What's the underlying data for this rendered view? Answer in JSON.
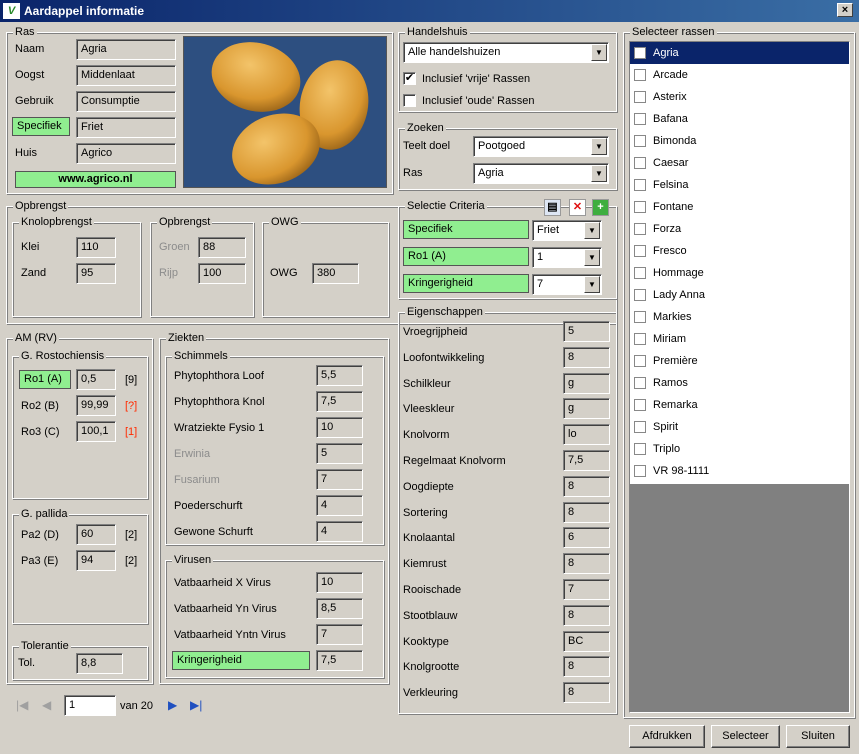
{
  "window": {
    "title": "Aardappel informatie",
    "close": "×",
    "logo": "V"
  },
  "ras": {
    "legend": "Ras",
    "rows": [
      {
        "label": "Naam",
        "value": "Agria",
        "highlight": false
      },
      {
        "label": "Oogst",
        "value": "Middenlaat",
        "highlight": false
      },
      {
        "label": "Gebruik",
        "value": "Consumptie",
        "highlight": false
      },
      {
        "label": "Specifiek",
        "value": "Friet",
        "highlight": true
      },
      {
        "label": "Huis",
        "value": "Agrico",
        "highlight": false
      }
    ],
    "website": "www.agrico.nl"
  },
  "opbrengst": {
    "legend": "Opbrengst",
    "knol": {
      "legend": "Knolopbrengst",
      "rows": [
        {
          "label": "Klei",
          "value": "110"
        },
        {
          "label": "Zand",
          "value": "95"
        }
      ]
    },
    "opb": {
      "legend": "Opbrengst",
      "rows": [
        {
          "label": "Groen",
          "value": "88"
        },
        {
          "label": "Rijp",
          "value": "100"
        }
      ]
    },
    "owg": {
      "legend": "OWG",
      "label": "OWG",
      "value": "380"
    }
  },
  "am": {
    "legend": "AM (RV)",
    "ro": {
      "legend": "G. Rostochiensis",
      "rows": [
        {
          "label": "Ro1 (A)",
          "value": "0,5",
          "note": "[9]"
        },
        {
          "label": "Ro2 (B)",
          "value": "99,99",
          "note": "[?]"
        },
        {
          "label": "Ro3 (C)",
          "value": "100,1",
          "note": "[1]"
        }
      ]
    },
    "pa": {
      "legend": "G. pallida",
      "rows": [
        {
          "label": "Pa2 (D)",
          "value": "60",
          "note": "[2]"
        },
        {
          "label": "Pa3 (E)",
          "value": "94",
          "note": "[2]"
        }
      ]
    },
    "tol": {
      "legend": "Tolerantie",
      "label": "Tol.",
      "value": "8,8"
    }
  },
  "ziekten": {
    "legend": "Ziekten",
    "schimmels": {
      "legend": "Schimmels",
      "rows": [
        {
          "label": "Phytophthora Loof",
          "value": "5,5"
        },
        {
          "label": "Phytophthora Knol",
          "value": "7,5"
        },
        {
          "label": "Wratziekte Fysio 1",
          "value": "10"
        },
        {
          "label": "Erwinia",
          "value": "5"
        },
        {
          "label": "Fusarium",
          "value": "7"
        },
        {
          "label": "Poederschurft",
          "value": "4"
        },
        {
          "label": "Gewone Schurft",
          "value": "4"
        }
      ]
    },
    "virussen": {
      "legend": "Virusen",
      "rows": [
        {
          "label": "Vatbaarheid X Virus",
          "value": "10"
        },
        {
          "label": "Vatbaarheid Yn Virus",
          "value": "8,5"
        },
        {
          "label": "Vatbaarheid Yntn Virus",
          "value": "7"
        },
        {
          "label": "Kringerigheid",
          "value": "7,5"
        }
      ]
    }
  },
  "handelshuis": {
    "legend": "Handelshuis",
    "select": "Alle handelshuizen",
    "check1": {
      "label": "Inclusief 'vrije' Rassen",
      "checked": true
    },
    "check2": {
      "label": "Inclusief 'oude' Rassen",
      "checked": false
    }
  },
  "zoeken": {
    "legend": "Zoeken",
    "teelt_label": "Teelt doel",
    "teelt_value": "Pootgoed",
    "ras_label": "Ras",
    "ras_value": "Agria"
  },
  "criteria": {
    "legend": "Selectie Criteria",
    "rows": [
      {
        "label": "Specifiek",
        "value": "Friet"
      },
      {
        "label": "Ro1 (A)",
        "value": "1"
      },
      {
        "label": "Kringerigheid",
        "value": "7"
      }
    ]
  },
  "eigenschappen": {
    "legend": "Eigenschappen",
    "rows": [
      {
        "label": "Vroegrijpheid",
        "value": "5"
      },
      {
        "label": "Loofontwikkeling",
        "value": "8"
      },
      {
        "label": "Schilkleur",
        "value": "g"
      },
      {
        "label": "Vleeskleur",
        "value": "g"
      },
      {
        "label": "Knolvorm",
        "value": "lo"
      },
      {
        "label": "Regelmaat Knolvorm",
        "value": "7,5"
      },
      {
        "label": "Oogdiepte",
        "value": "8"
      },
      {
        "label": "Sortering",
        "value": "8"
      },
      {
        "label": "Knolaantal",
        "value": "6"
      },
      {
        "label": "Kiemrust",
        "value": "8"
      },
      {
        "label": "Rooischade",
        "value": "7"
      },
      {
        "label": "Stootblauw",
        "value": "8"
      },
      {
        "label": "Kooktype",
        "value": "BC"
      },
      {
        "label": "Knolgrootte",
        "value": "8"
      },
      {
        "label": "Verkleuring",
        "value": "8"
      }
    ]
  },
  "rassen": {
    "legend": "Selecteer rassen",
    "items": [
      "Agria",
      "Arcade",
      "Asterix",
      "Bafana",
      "Bimonda",
      "Caesar",
      "Felsina",
      "Fontane",
      "Forza",
      "Fresco",
      "Hommage",
      "Lady Anna",
      "Markies",
      "Miriam",
      "Première",
      "Ramos",
      "Remarka",
      "Spirit",
      "Triplo",
      "VR 98-1111"
    ],
    "selected": 0
  },
  "pager": {
    "first": "|◀",
    "prev": "◀",
    "page": "1",
    "of": "van 20",
    "next": "▶",
    "last": "▶|"
  },
  "buttons": {
    "print": "Afdrukken",
    "select": "Selecteer",
    "close": "Sluiten"
  }
}
